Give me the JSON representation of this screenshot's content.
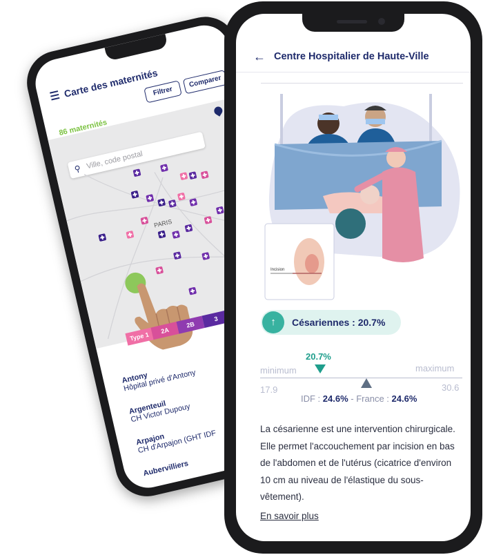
{
  "colors": {
    "navy": "#1e2a6b",
    "teal": "#38b2a0",
    "green": "#7cc242",
    "pink": "#f06fa6",
    "purple": "#6f2dab",
    "dark_purple": "#3a1f8a"
  },
  "map_screen": {
    "title": "Carte des maternités",
    "filter_label": "Filtrer",
    "compare_label": "Comparer",
    "count": "86 maternités",
    "search_placeholder": "Ville, code postal",
    "map_labels": {
      "paris": "PARIS"
    },
    "type_legend": [
      {
        "label": "Type 1",
        "color": "#f06fa6"
      },
      {
        "label": "2A",
        "color": "#d8509a"
      },
      {
        "label": "2B",
        "color": "#8f3bb0"
      },
      {
        "label": "3",
        "color": "#5a2aa0"
      }
    ],
    "list": [
      {
        "city": "Antony",
        "hospital": "Hôpital privé d'Antony"
      },
      {
        "city": "Argenteuil",
        "hospital": "CH Victor Dupouy"
      },
      {
        "city": "Arpajon",
        "hospital": "CH d'Arpajon (GHT IDF"
      },
      {
        "city": "Aubervilliers",
        "hospital": ""
      }
    ]
  },
  "detail_screen": {
    "back_icon": "arrow-left-icon",
    "title": "Centre Hospitalier de Haute-Ville",
    "illustration_inset_label": "Incision",
    "stat": {
      "icon": "arrow-up-icon",
      "label": "Césariennes : 20.7%"
    },
    "scale": {
      "value_label": "20.7%",
      "value": 20.7,
      "reference": 24.6,
      "min_label": "minimum",
      "max_label": "maximum",
      "min_value": "17.9",
      "max_value": "30.6",
      "idf_label": "IDF : ",
      "idf_value": "24.6%",
      "france_label": " - France : ",
      "france_value": "24.6%"
    },
    "description": "La césarienne est une intervention chirurgicale. Elle permet l'accouchement par incision en bas de l'abdomen et de l'utérus (cicatrice d'environ 10 cm au niveau de l'élastique du sous-vêtement).",
    "more_link": "En savoir plus"
  }
}
